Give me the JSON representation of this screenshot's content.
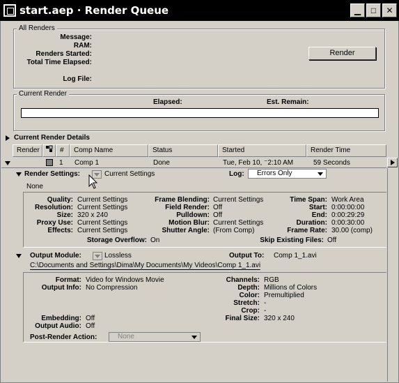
{
  "window": {
    "title": "start.aep · Render Queue",
    "minimize": "▁",
    "maximize": "□",
    "close": "✕"
  },
  "all_renders": {
    "label": "All Renders",
    "message_label": "Message:",
    "ram_label": "RAM:",
    "started_label": "Renders Started:",
    "elapsed_label": "Total Time Elapsed:",
    "logfile_label": "Log File:",
    "render_button": "Render"
  },
  "current_render": {
    "label": "Current Render",
    "elapsed_label": "Elapsed:",
    "remain_label": "Est. Remain:",
    "details_label": "Current Render Details"
  },
  "columns": {
    "render": "Render",
    "num": "#",
    "comp_name": "Comp Name",
    "status": "Status",
    "started": "Started",
    "render_time": "Render Time"
  },
  "queue_item": {
    "num": "1",
    "comp_name": "Comp 1",
    "status": "Done",
    "started": "Tue, Feb 10, ⁻2:10 AM",
    "render_time": "59 Seconds",
    "label_color": "#808080"
  },
  "render_settings": {
    "label": "Render Settings:",
    "value": "Current Settings",
    "log_label": "Log:",
    "log_value": "Errors Only",
    "note": "None",
    "quality_l": "Quality:",
    "quality_v": "Current Settings",
    "resolution_l": "Resolution:",
    "resolution_v": "Current Settings",
    "size_l": "Size:",
    "size_v": "320 x 240",
    "proxy_l": "Proxy Use:",
    "proxy_v": "Current Settings",
    "effects_l": "Effects:",
    "effects_v": "Current Settings",
    "frameblend_l": "Frame Blending:",
    "frameblend_v": "Current Settings",
    "fieldrender_l": "Field Render:",
    "fieldrender_v": "Off",
    "pulldown_l": "Pulldown:",
    "pulldown_v": "Off",
    "motionblur_l": "Motion Blur:",
    "motionblur_v": "Current Settings",
    "shutter_l": "Shutter Angle:",
    "shutter_v": "(From Comp)",
    "timespan_l": "Time Span:",
    "timespan_v": "Work Area",
    "start_l": "Start:",
    "start_v": "0:00:00:00",
    "end_l": "End:",
    "end_v": "0:00:29:29",
    "duration_l": "Duration:",
    "duration_v": "0:00:30:00",
    "framerate_l": "Frame Rate:",
    "framerate_v": "30.00 (comp)",
    "overflow_l": "Storage Overflow:",
    "overflow_v": "On",
    "skip_l": "Skip Existing Files:",
    "skip_v": "Off"
  },
  "output_module": {
    "label": "Output Module:",
    "value": "Lossless",
    "output_to_label": "Output To:",
    "output_to_value": "Comp 1_1.avi",
    "path": "C:\\Documents and Settings\\Dima\\My Documents\\My Videos\\Comp 1_1.avi",
    "format_l": "Format:",
    "format_v": "Video for Windows Movie",
    "outinfo_l": "Output Info:",
    "outinfo_v": "No Compression",
    "embedding_l": "Embedding:",
    "embedding_v": "Off",
    "outaudio_l": "Output Audio:",
    "outaudio_v": "Off",
    "channels_l": "Channels:",
    "channels_v": "RGB",
    "depth_l": "Depth:",
    "depth_v": "Millions of Colors",
    "color_l": "Color:",
    "color_v": "Premultiplied",
    "stretch_l": "Stretch:",
    "stretch_v": "-",
    "crop_l": "Crop:",
    "crop_v": "-",
    "finalsize_l": "Final Size:",
    "finalsize_v": "320 x 240",
    "postrender_l": "Post-Render Action:",
    "postrender_v": "None"
  }
}
